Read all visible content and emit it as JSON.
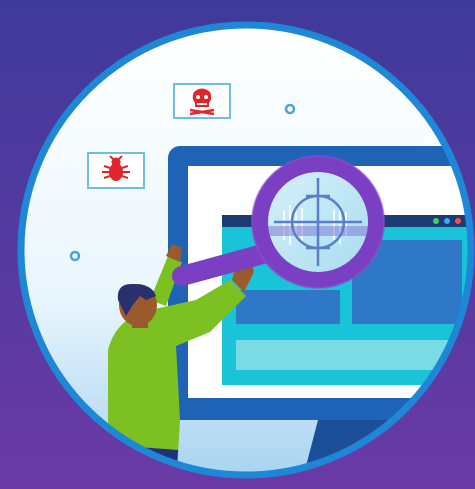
{
  "colors": {
    "background_top": "#3f3a9a",
    "background_bottom": "#6a3aa6",
    "circle_ring": "#1e88d6",
    "circle_fill_top": "#ffffff",
    "circle_fill_bottom": "#a9d4f2",
    "monitor_frame": "#1f63b6",
    "monitor_screen": "#ffffff",
    "app_panel": "#19c3d8",
    "app_titlebar": "#1c3b73",
    "app_tile_dark": "#2f78c7",
    "app_tile_light": "#7adbe6",
    "magnifier_ring": "#7b3fc4",
    "magnifier_handle": "#7b3fc4",
    "bug_red": "#e0262c",
    "person_shirt": "#7cc022",
    "person_skin": "#9a5a2c",
    "person_hair": "#2a2f6e",
    "window_dot_green": "#3fcf6a",
    "window_dot_blue": "#39a6ff",
    "window_dot_red": "#ff4b4b"
  },
  "icons": {
    "threat_cards": [
      "skull-icon",
      "bug-icon"
    ],
    "tool": "magnifying-glass-icon",
    "crosshair": "crosshair-icon"
  }
}
